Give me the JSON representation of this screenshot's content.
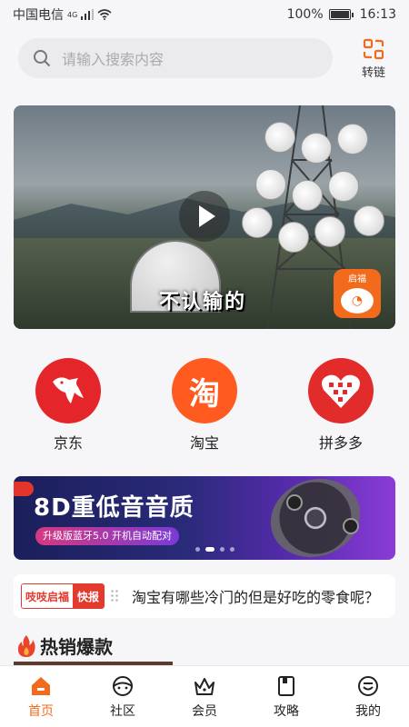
{
  "status": {
    "carrier": "中国电信",
    "network": "4G",
    "battery": "100%",
    "time": "16:13"
  },
  "search": {
    "placeholder": "请输入搜索内容",
    "convert_label": "转链"
  },
  "video_banner": {
    "caption": "不认输的",
    "badge_text": "启福"
  },
  "shortcuts": [
    {
      "label": "京东",
      "icon": "jd-dog-icon",
      "color": "#e4262b"
    },
    {
      "label": "淘宝",
      "icon": "taobao-icon",
      "glyph": "淘",
      "color": "#ff5a1f"
    },
    {
      "label": "拼多多",
      "icon": "pinduoduo-icon",
      "color": "#e22b2b"
    }
  ],
  "promo": {
    "title": "8D重低音音质",
    "subtitle": "升级版蓝牙5.0 开机自动配对",
    "active_slide": 1,
    "slide_count": 4
  },
  "news": {
    "tag_brand": "吱吱启福",
    "tag_label": "快报",
    "text": "淘宝有哪些冷门的但是好吃的零食呢？"
  },
  "hot_section": {
    "title": "热销爆款"
  },
  "tabbar": {
    "items": [
      {
        "label": "首页",
        "icon": "home-icon",
        "active": true
      },
      {
        "label": "社区",
        "icon": "community-icon",
        "active": false
      },
      {
        "label": "会员",
        "icon": "crown-icon",
        "active": false
      },
      {
        "label": "攻略",
        "icon": "guide-icon",
        "active": false
      },
      {
        "label": "我的",
        "icon": "profile-icon",
        "active": false
      }
    ]
  },
  "colors": {
    "accent": "#f26b1d",
    "brand_red": "#e33a2e"
  }
}
